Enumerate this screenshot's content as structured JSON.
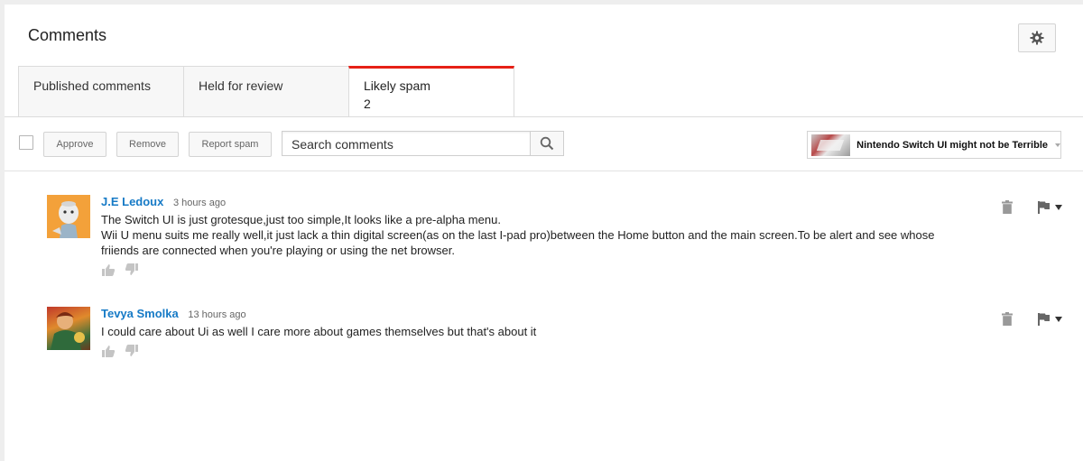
{
  "header": {
    "title": "Comments",
    "settings_icon": "gear-icon"
  },
  "tabs": [
    {
      "label": "Published comments",
      "count": "",
      "active": false
    },
    {
      "label": "Held for review",
      "count": "",
      "active": false
    },
    {
      "label": "Likely spam",
      "count": "2",
      "active": true
    }
  ],
  "toolbar": {
    "approve_label": "Approve",
    "remove_label": "Remove",
    "report_spam_label": "Report spam",
    "search_placeholder": "Search comments",
    "search_value": ""
  },
  "video_filter": {
    "title": "Nintendo Switch UI might not be Terrible"
  },
  "comments": [
    {
      "author": "J.E Ledoux",
      "time": "3 hours ago",
      "text": "The Switch UI is just grotesque,just too simple,It looks like a pre-alpha menu.\nWii U menu suits me really well,it just lack a thin digital screen(as on the last I-pad pro)between the Home button and the main screen.To be alert and see whose friiends are connected when you're playing or using the net browser."
    },
    {
      "author": "Tevya Smolka",
      "time": "13 hours ago",
      "text": "I could care about Ui as well I care more about games themselves but that's about it"
    }
  ],
  "colors": {
    "accent": "#e62117",
    "author_link": "#167ac6"
  }
}
